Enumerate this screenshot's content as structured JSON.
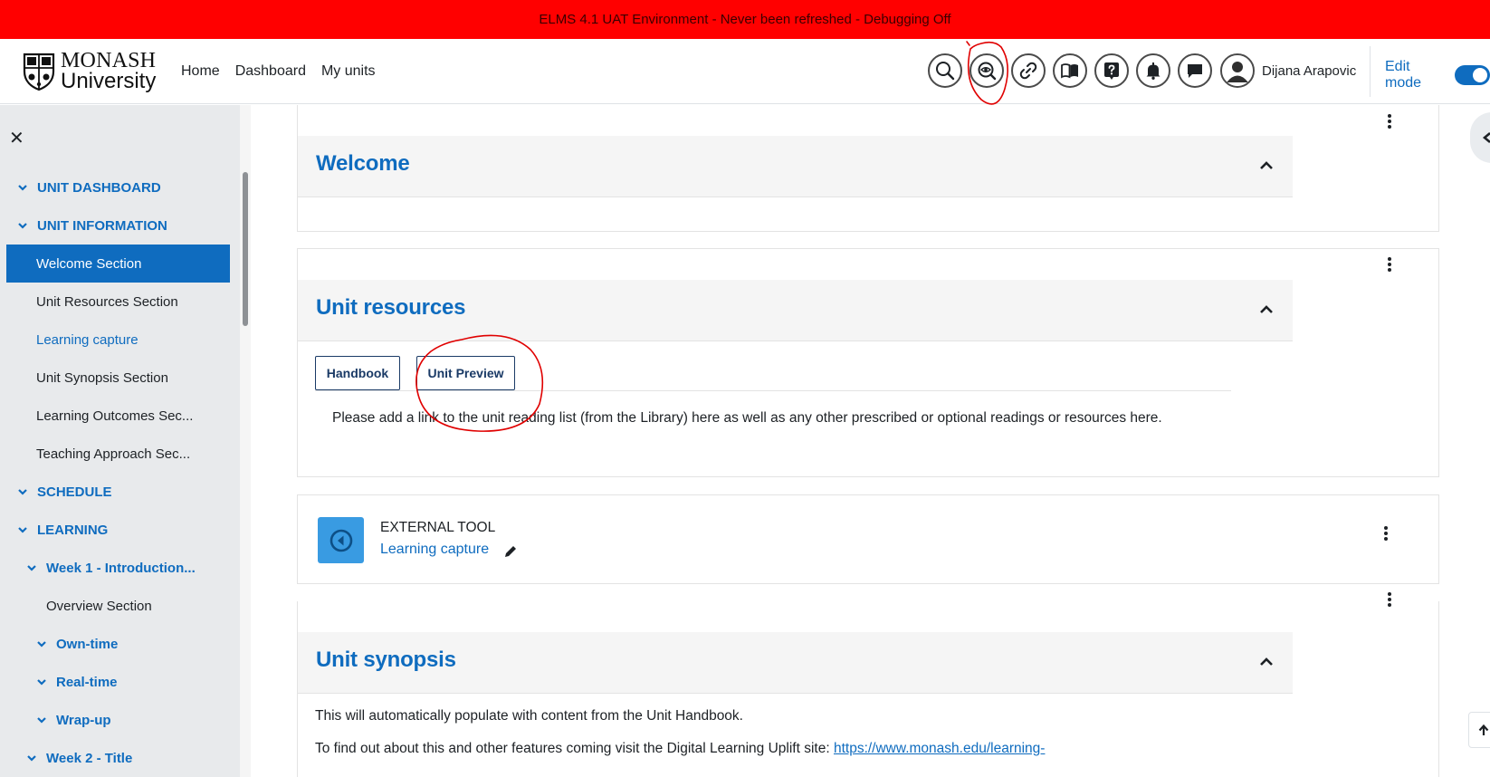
{
  "banner": {
    "text": "ELMS 4.1 UAT Environment - Never been refreshed - Debugging Off"
  },
  "logo": {
    "line1": "MONASH",
    "line2": "University"
  },
  "nav": {
    "items": [
      "Home",
      "Dashboard",
      "My units"
    ]
  },
  "nav_icons": [
    "search-icon",
    "eye-search-icon",
    "link-icon",
    "book-icon",
    "help-icon",
    "bell-icon",
    "chat-icon"
  ],
  "user": {
    "name": "Dijana Arapovic"
  },
  "edit_mode": {
    "label": "Edit mode",
    "on": true
  },
  "colors": {
    "accent": "#0f6cbf",
    "banner": "#ff0000",
    "annotation": "#e00000",
    "activity": "#399be2"
  },
  "drawer": {
    "items": [
      {
        "label": "UNIT DASHBOARD",
        "type": "section",
        "expanded": true
      },
      {
        "label": "UNIT INFORMATION",
        "type": "section",
        "expanded": true
      },
      {
        "label": "Welcome Section",
        "type": "item",
        "active": true
      },
      {
        "label": "Unit Resources Section",
        "type": "item"
      },
      {
        "label": "Learning capture",
        "type": "link"
      },
      {
        "label": "Unit Synopsis Section",
        "type": "item"
      },
      {
        "label": "Learning Outcomes Sec...",
        "type": "item"
      },
      {
        "label": "Teaching Approach Sec...",
        "type": "item"
      },
      {
        "label": "SCHEDULE",
        "type": "section",
        "expanded": true
      },
      {
        "label": "LEARNING",
        "type": "section",
        "expanded": true
      },
      {
        "label": "Week 1 - Introduction...",
        "type": "sub",
        "expanded": true
      },
      {
        "label": "Overview Section",
        "type": "item"
      },
      {
        "label": "Own-time",
        "type": "sub2",
        "expanded": true
      },
      {
        "label": "Real-time",
        "type": "sub2",
        "expanded": true
      },
      {
        "label": "Wrap-up",
        "type": "sub2",
        "expanded": true
      },
      {
        "label": "Week 2 - Title",
        "type": "sub",
        "expanded": true
      }
    ]
  },
  "sections": {
    "welcome": {
      "title": "Welcome"
    },
    "resources": {
      "title": "Unit resources",
      "buttons": [
        "Handbook",
        "Unit Preview"
      ],
      "text": "Please add a link to the unit reading list (from the Library) here as well as any other prescribed or optional readings or resources here."
    },
    "activity": {
      "type_label": "EXTERNAL TOOL",
      "name": "Learning capture"
    },
    "synopsis": {
      "title": "Unit synopsis",
      "text1": "This will automatically populate with content from the Unit Handbook.",
      "text2_prefix": "To find out about this and other features coming visit the Digital Learning Uplift site: ",
      "text2_link": "https://www.monash.edu/learning-"
    }
  }
}
